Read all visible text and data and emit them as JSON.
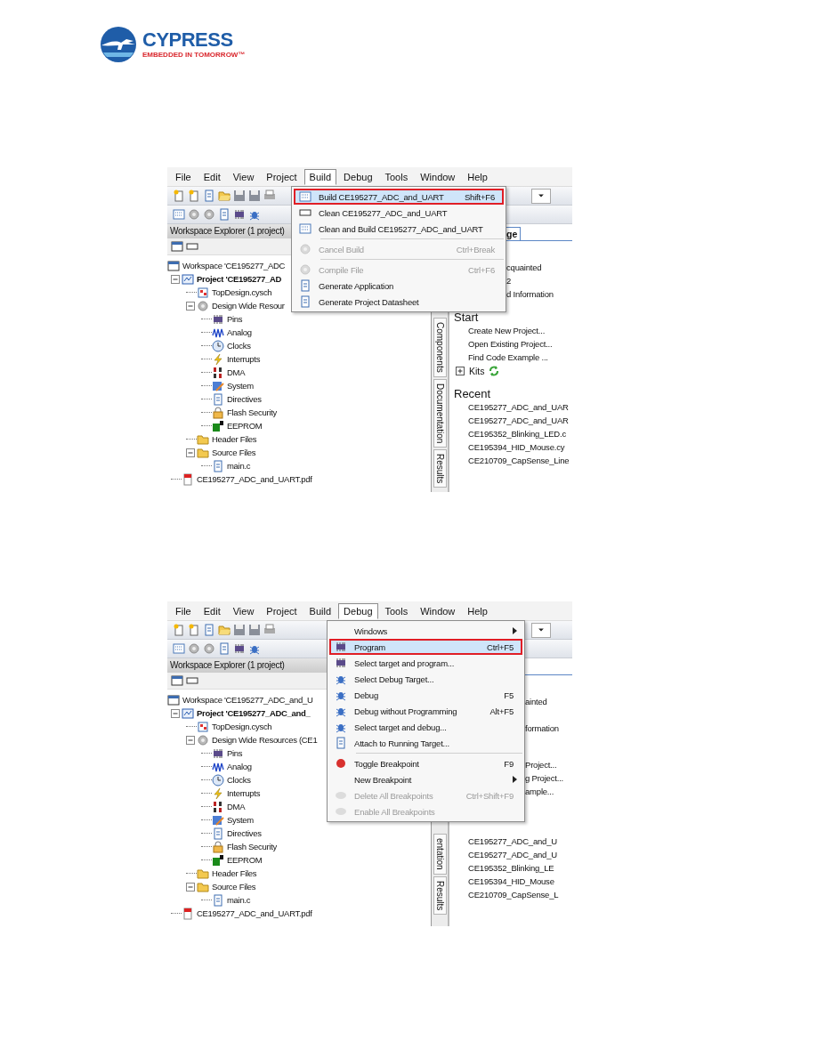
{
  "logo": {
    "name": "CYPRESS",
    "tagline": "EMBEDDED IN TOMORROW™"
  },
  "screens": [
    {
      "menubar": [
        {
          "label": "File",
          "open": false
        },
        {
          "label": "Edit",
          "open": false
        },
        {
          "label": "View",
          "open": false
        },
        {
          "label": "Project",
          "open": false
        },
        {
          "label": "Build",
          "open": true
        },
        {
          "label": "Debug",
          "open": false
        },
        {
          "label": "Tools",
          "open": false
        },
        {
          "label": "Window",
          "open": false
        },
        {
          "label": "Help",
          "open": false
        }
      ],
      "explorer": {
        "title": "Workspace Explorer (1 project)",
        "tree": [
          {
            "label": "Workspace 'CE195277_ADC",
            "kind": "workspace",
            "children": [
              {
                "label": "Project 'CE195277_AD",
                "kind": "project",
                "children": [
                  {
                    "label": "TopDesign.cysch",
                    "kind": "schematic"
                  },
                  {
                    "label": "Design Wide Resour",
                    "kind": "resources",
                    "children": [
                      {
                        "label": "Pins",
                        "kind": "pins"
                      },
                      {
                        "label": "Analog",
                        "kind": "analog"
                      },
                      {
                        "label": "Clocks",
                        "kind": "clock"
                      },
                      {
                        "label": "Interrupts",
                        "kind": "interrupt"
                      },
                      {
                        "label": "DMA",
                        "kind": "dma"
                      },
                      {
                        "label": "System",
                        "kind": "system"
                      },
                      {
                        "label": "Directives",
                        "kind": "directive"
                      },
                      {
                        "label": "Flash Security",
                        "kind": "security"
                      },
                      {
                        "label": "EEPROM",
                        "kind": "eeprom"
                      }
                    ]
                  },
                  {
                    "label": "Header Files",
                    "kind": "folder"
                  },
                  {
                    "label": "Source Files",
                    "kind": "folder",
                    "children": [
                      {
                        "label": "main.c",
                        "kind": "cfile"
                      }
                    ]
                  }
                ]
              },
              {
                "label": "CE195277_ADC_and_UART.pdf",
                "kind": "pdf"
              }
            ]
          }
        ]
      },
      "side_tabs": [
        "Components",
        "Documentation",
        "Results"
      ],
      "start_tab": "ge",
      "start_page": {
        "intro": [
          {
            "text": "cquainted",
            "kind": "cut"
          },
          {
            "text": "2",
            "kind": "cut"
          },
          {
            "text": "d Information",
            "kind": "cut"
          }
        ],
        "start_heading": "Start",
        "links": [
          {
            "text": "Create New Project...",
            "kind": "full"
          },
          {
            "text": "Open Existing Project...",
            "kind": "full"
          },
          {
            "text": "Find Code Example ...",
            "kind": "full"
          }
        ],
        "kits": "Kits",
        "recent_heading": "Recent",
        "recent": [
          "CE195277_ADC_and_UAR",
          "CE195277_ADC_and_UAR",
          "CE195352_Blinking_LED.c",
          "CE195394_HID_Mouse.cy",
          "CE210709_CapSense_Line"
        ]
      },
      "menu": {
        "items": [
          {
            "label": "Build CE195277_ADC_and_UART",
            "shortcut": "Shift+F6",
            "kind": "build",
            "selected": true,
            "disabled": false,
            "submenu": false
          },
          {
            "label": "Clean CE195277_ADC_and_UART",
            "kind": "clean",
            "selected": false,
            "disabled": false,
            "submenu": false
          },
          {
            "label": "Clean and Build CE195277_ADC_and_UART",
            "kind": "rebuild",
            "selected": false,
            "disabled": false,
            "submenu": false
          },
          {
            "kind": "separator"
          },
          {
            "label": "Cancel Build",
            "shortcut": "Ctrl+Break",
            "kind": "cancel",
            "selected": false,
            "disabled": true,
            "submenu": false
          },
          {
            "kind": "separator"
          },
          {
            "label": "Compile File",
            "shortcut": "Ctrl+F6",
            "kind": "compile",
            "selected": false,
            "disabled": true,
            "submenu": false
          },
          {
            "label": "Generate Application",
            "kind": "generate",
            "selected": false,
            "disabled": false,
            "submenu": false
          },
          {
            "label": "Generate Project Datasheet",
            "kind": "datasheet",
            "selected": false,
            "disabled": false,
            "submenu": false
          }
        ]
      }
    },
    {
      "menubar": [
        {
          "label": "File",
          "open": false
        },
        {
          "label": "Edit",
          "open": false
        },
        {
          "label": "View",
          "open": false
        },
        {
          "label": "Project",
          "open": false
        },
        {
          "label": "Build",
          "open": false
        },
        {
          "label": "Debug",
          "open": true
        },
        {
          "label": "Tools",
          "open": false
        },
        {
          "label": "Window",
          "open": false
        },
        {
          "label": "Help",
          "open": false
        }
      ],
      "explorer": {
        "title": "Workspace Explorer (1 project)",
        "tree": [
          {
            "label": "Workspace 'CE195277_ADC_and_U",
            "kind": "workspace",
            "children": [
              {
                "label": "Project 'CE195277_ADC_and_",
                "kind": "project",
                "children": [
                  {
                    "label": "TopDesign.cysch",
                    "kind": "schematic"
                  },
                  {
                    "label": "Design Wide Resources (CE1",
                    "kind": "resources",
                    "children": [
                      {
                        "label": "Pins",
                        "kind": "pins"
                      },
                      {
                        "label": "Analog",
                        "kind": "analog"
                      },
                      {
                        "label": "Clocks",
                        "kind": "clock"
                      },
                      {
                        "label": "Interrupts",
                        "kind": "interrupt"
                      },
                      {
                        "label": "DMA",
                        "kind": "dma"
                      },
                      {
                        "label": "System",
                        "kind": "system"
                      },
                      {
                        "label": "Directives",
                        "kind": "directive"
                      },
                      {
                        "label": "Flash Security",
                        "kind": "security"
                      },
                      {
                        "label": "EEPROM",
                        "kind": "eeprom"
                      }
                    ]
                  },
                  {
                    "label": "Header Files",
                    "kind": "folder"
                  },
                  {
                    "label": "Source Files",
                    "kind": "folder",
                    "children": [
                      {
                        "label": "main.c",
                        "kind": "cfile"
                      }
                    ]
                  }
                ]
              },
              {
                "label": "CE195277_ADC_and_UART.pdf",
                "kind": "pdf"
              }
            ]
          }
        ]
      },
      "side_tabs": [
        "entation",
        "Results"
      ],
      "start_page": {
        "intro": [
          {
            "text": "ainted",
            "kind": "cut"
          },
          {
            "text": "formation",
            "kind": "cut"
          }
        ],
        "links": [
          {
            "text": "Project...",
            "kind": "cut"
          },
          {
            "text": "g Project...",
            "kind": "cut"
          },
          {
            "text": "ample...",
            "kind": "cut"
          }
        ],
        "recent": [
          "CE195277_ADC_and_U",
          "CE195277_ADC_and_U",
          "CE195352_Blinking_LE",
          "CE195394_HID_Mouse",
          "CE210709_CapSense_L"
        ]
      },
      "menu": {
        "items": [
          {
            "label": "Windows",
            "kind": "windows",
            "selected": false,
            "disabled": false,
            "submenu": true
          },
          {
            "label": "Program",
            "shortcut": "Ctrl+F5",
            "kind": "program",
            "selected": true,
            "disabled": false,
            "submenu": false
          },
          {
            "label": "Select target and program...",
            "kind": "target",
            "selected": false,
            "disabled": false,
            "submenu": false
          },
          {
            "label": "Select Debug Target...",
            "kind": "debugtarget",
            "selected": false,
            "disabled": false,
            "submenu": false
          },
          {
            "label": "Debug",
            "shortcut": "F5",
            "kind": "debug",
            "selected": false,
            "disabled": false,
            "submenu": false
          },
          {
            "label": "Debug without Programming",
            "shortcut": "Alt+F5",
            "kind": "nodebug",
            "selected": false,
            "disabled": false,
            "submenu": false
          },
          {
            "label": "Select target and debug...",
            "kind": "debug",
            "selected": false,
            "disabled": false,
            "submenu": false
          },
          {
            "label": "Attach to Running Target...",
            "kind": "attach",
            "selected": false,
            "disabled": false,
            "submenu": false
          },
          {
            "kind": "separator"
          },
          {
            "label": "Toggle Breakpoint",
            "shortcut": "F9",
            "kind": "breakpoint",
            "selected": false,
            "disabled": false,
            "submenu": false
          },
          {
            "label": "New Breakpoint",
            "kind": "newbp",
            "selected": false,
            "disabled": false,
            "submenu": true
          },
          {
            "label": "Delete All Breakpoints",
            "shortcut": "Ctrl+Shift+F9",
            "kind": "deletebp",
            "selected": false,
            "disabled": true,
            "submenu": false
          },
          {
            "label": "Enable All Breakpoints",
            "kind": "enablebp",
            "selected": false,
            "disabled": true,
            "submenu": false
          }
        ]
      }
    }
  ]
}
